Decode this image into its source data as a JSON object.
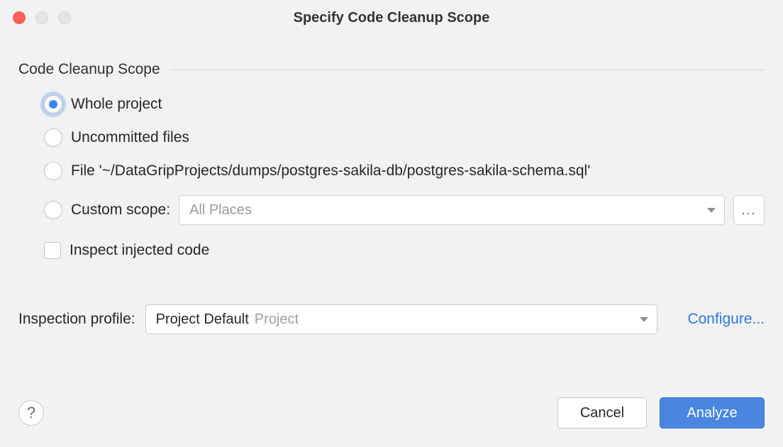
{
  "window": {
    "title": "Specify Code Cleanup Scope"
  },
  "section": {
    "title": "Code Cleanup Scope"
  },
  "scope": {
    "whole_project": "Whole project",
    "uncommitted_files": "Uncommitted files",
    "file": "File '~/DataGripProjects/dumps/postgres-sakila-db/postgres-sakila-schema.sql'",
    "custom_scope": "Custom scope:",
    "custom_scope_value": "All Places",
    "ellipsis": "...",
    "selected": "whole_project"
  },
  "inspect_injected": {
    "label": "Inspect injected code",
    "checked": false
  },
  "profile": {
    "label": "Inspection profile:",
    "selected_main": "Project Default",
    "selected_scope": "Project",
    "configure": "Configure..."
  },
  "footer": {
    "help": "?",
    "cancel": "Cancel",
    "analyze": "Analyze"
  }
}
